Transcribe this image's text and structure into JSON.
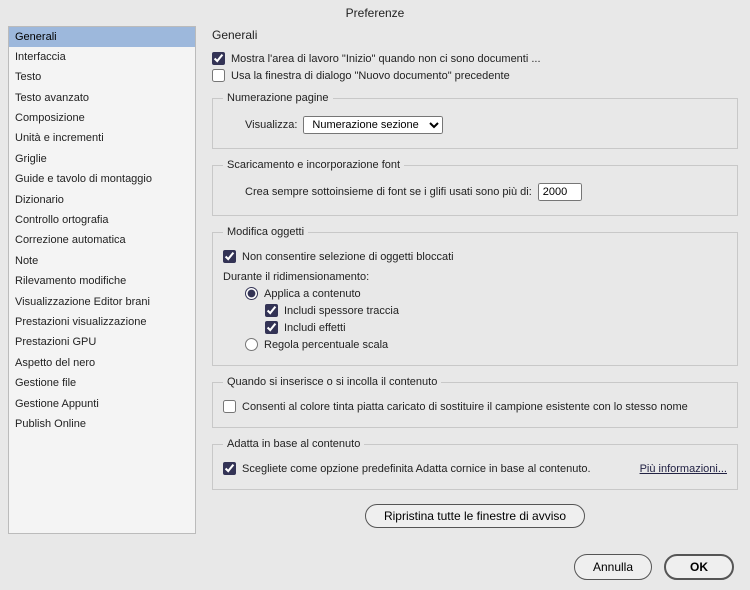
{
  "title": "Preferenze",
  "sidebar": {
    "items": [
      {
        "label": "Generali",
        "selected": true
      },
      {
        "label": "Interfaccia"
      },
      {
        "label": "Testo"
      },
      {
        "label": "Testo avanzato"
      },
      {
        "label": "Composizione"
      },
      {
        "label": "Unità e incrementi"
      },
      {
        "label": "Griglie"
      },
      {
        "label": "Guide e tavolo di montaggio"
      },
      {
        "label": "Dizionario"
      },
      {
        "label": "Controllo ortografia"
      },
      {
        "label": "Correzione automatica"
      },
      {
        "label": "Note"
      },
      {
        "label": "Rilevamento modifiche"
      },
      {
        "label": "Visualizzazione Editor brani"
      },
      {
        "label": "Prestazioni visualizzazione"
      },
      {
        "label": "Prestazioni GPU"
      },
      {
        "label": "Aspetto del nero"
      },
      {
        "label": "Gestione file"
      },
      {
        "label": "Gestione Appunti"
      },
      {
        "label": "Publish Online"
      }
    ]
  },
  "main": {
    "heading": "Generali",
    "show_start": {
      "label": "Mostra l'area di lavoro \"Inizio\" quando non ci sono documenti ...",
      "checked": true
    },
    "use_legacy": {
      "label": "Usa la finestra di dialogo \"Nuovo documento\" precedente",
      "checked": false
    },
    "page_num": {
      "legend": "Numerazione pagine",
      "view_label": "Visualizza:",
      "selected": "Numerazione sezione"
    },
    "fonts": {
      "legend": "Scaricamento e incorporazione font",
      "subset_label": "Crea sempre sottoinsieme di font se i glifi usati sono più di:",
      "subset_value": "2000"
    },
    "objects": {
      "legend": "Modifica oggetti",
      "prevent_label": "Non consentire selezione di oggetti bloccati",
      "prevent_checked": true,
      "scaling_label": "Durante il ridimensionamento:",
      "apply_content": "Applica a contenuto",
      "include_stroke": "Includi spessore traccia",
      "include_stroke_checked": true,
      "include_effects": "Includi effetti",
      "include_effects_checked": true,
      "adjust_pct": "Regola percentuale scala"
    },
    "paste": {
      "legend": "Quando si inserisce o si incolla il contenuto",
      "swatch_label": "Consenti al colore tinta piatta caricato di sostituire il campione esistente con lo stesso nome",
      "swatch_checked": false
    },
    "fit": {
      "legend": "Adatta in base al contenuto",
      "default_label": "Scegliete come opzione predefinita Adatta cornice in base al contenuto.",
      "default_checked": true,
      "more_info": "Più informazioni..."
    },
    "reset_button": "Ripristina tutte le finestre di avviso"
  },
  "footer": {
    "cancel": "Annulla",
    "ok": "OK"
  }
}
